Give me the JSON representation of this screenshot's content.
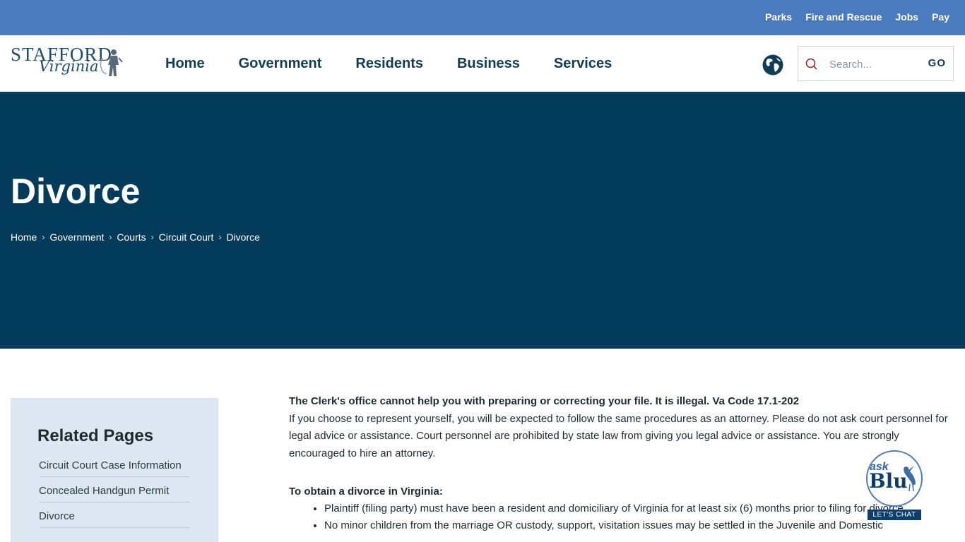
{
  "utility_nav": [
    "Parks",
    "Fire and Rescue",
    "Jobs",
    "Pay"
  ],
  "logo": {
    "line1": "STAFFORD",
    "line2": "Virginia"
  },
  "main_nav": [
    "Home",
    "Government",
    "Residents",
    "Business",
    "Services"
  ],
  "search": {
    "placeholder": "Search...",
    "button_label": "GO"
  },
  "page_title": "Divorce",
  "breadcrumbs": [
    "Home",
    "Government",
    "Courts",
    "Circuit Court",
    "Divorce"
  ],
  "sidebar": {
    "heading": "Related Pages",
    "links": [
      "Circuit Court Case Information",
      "Concealed Handgun Permit",
      "Divorce"
    ]
  },
  "content": {
    "notice": "The Clerk's office cannot help you with preparing or correcting your file.  It is illegal. Va Code 17.1-202",
    "paragraph": "If you choose to represent yourself, you will be expected to follow the same procedures as an attorney. Please do not ask court personnel for legal advice or assistance. Court personnel are prohibited by state law from giving you legal advice or assistance. You are strongly encouraged to hire an attorney.",
    "subheading": "To obtain a divorce in Virginia:",
    "requirements": [
      "Plaintiff (filing party) must have been a resident and domiciliary of Virginia for at least six (6) months prior to filing for divorce.",
      "No minor children from the marriage OR custody, support, visitation issues may be settled in the Juvenile and Domestic"
    ]
  },
  "chat_widget": {
    "ask": "ask",
    "name": "Blu",
    "cta": "LET'S CHAT"
  },
  "colors": {
    "utility_bar": "#4a7bbf",
    "hero": "#033b5b",
    "nav_text": "#0f3d56",
    "sidebar_bg": "#dce7f1"
  }
}
